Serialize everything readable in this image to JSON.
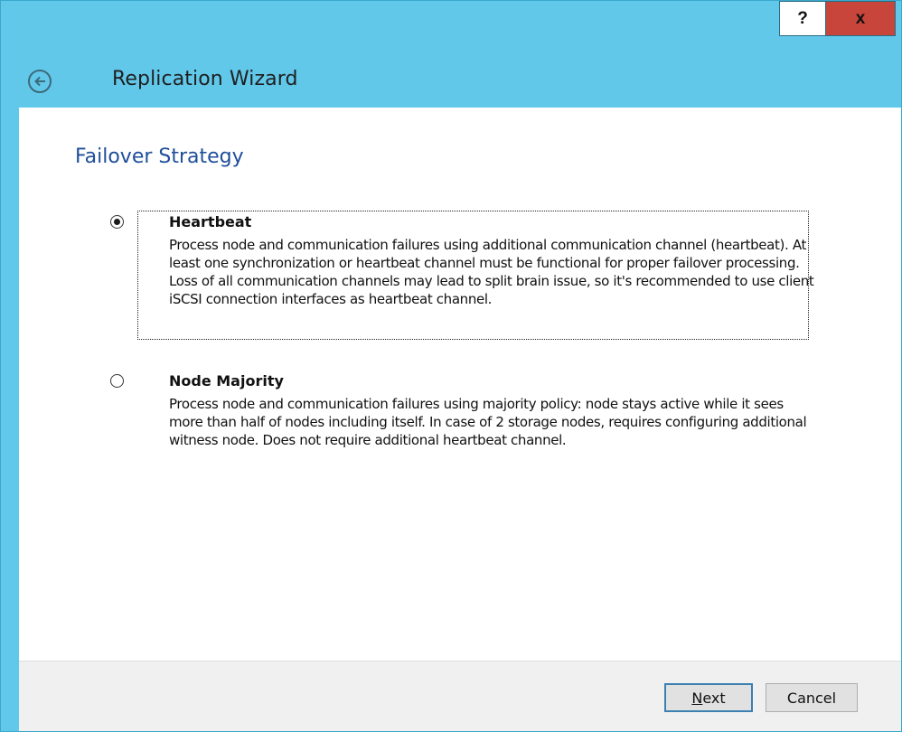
{
  "window": {
    "title": "Replication Wizard",
    "help_label": "?",
    "close_label": "x",
    "colors": {
      "chrome": "#61c8ea",
      "close": "#c7453b",
      "heading": "#1f4e9a"
    }
  },
  "page": {
    "title": "Failover Strategy"
  },
  "options": [
    {
      "title": "Heartbeat",
      "selected": true,
      "description": "Process node and communication failures using additional communication channel (heartbeat). At least one synchronization or heartbeat channel must be functional for proper failover processing. Loss of all communication channels may lead to split brain issue, so it's recommended to use client iSCSI connection interfaces as heartbeat channel."
    },
    {
      "title": "Node Majority",
      "selected": false,
      "description": "Process node and communication failures using majority policy: node stays active while it sees more than half of nodes including itself. In case of 2 storage nodes, requires configuring additional witness node. Does not require additional heartbeat channel."
    }
  ],
  "footer": {
    "next_label_first": "N",
    "next_label_rest": "ext",
    "cancel_label": "Cancel"
  },
  "icons": {
    "back": "back-arrow-icon"
  }
}
